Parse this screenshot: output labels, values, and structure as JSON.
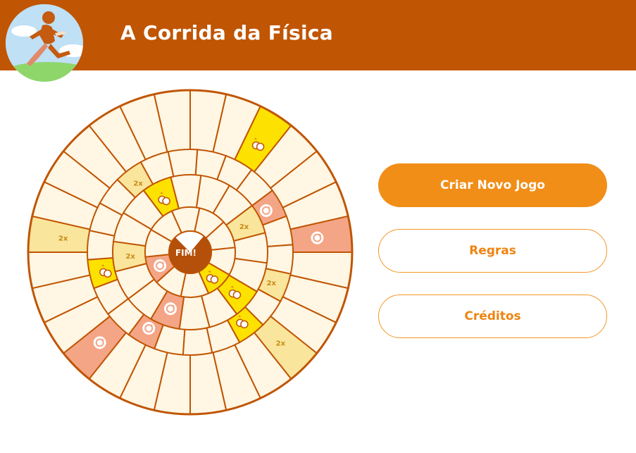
{
  "header": {
    "title": "A Corrida da Física"
  },
  "board": {
    "center_label": "FIM!",
    "double_label": "2x",
    "colors": {
      "ring": "#c05503",
      "cell": "#fff6e3",
      "double": "#f9e59b",
      "swap": "#f3a586",
      "link": "#fde100",
      "center": "#b4500a"
    }
  },
  "buttons": {
    "new_game": "Criar Novo Jogo",
    "rules": "Regras",
    "credits": "Créditos"
  }
}
